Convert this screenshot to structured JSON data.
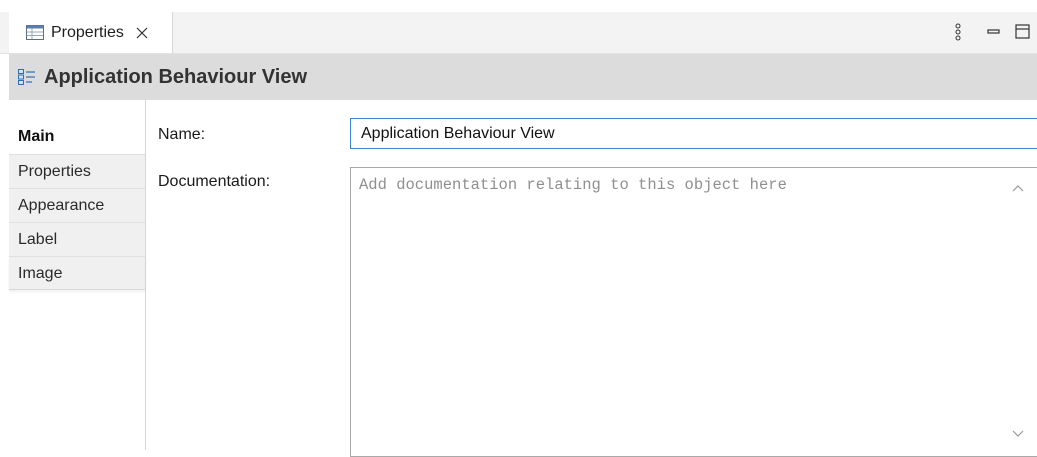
{
  "tab": {
    "label": "Properties",
    "icon": "properties-table-icon"
  },
  "toolbar": {
    "menu_icon": "view-menu-icon",
    "minimize_icon": "minimize-icon",
    "maximize_icon": "maximize-icon"
  },
  "header": {
    "title": "Application Behaviour View",
    "icon": "view-diagram-icon"
  },
  "sidebar": {
    "items": [
      {
        "label": "Main",
        "active": true
      },
      {
        "label": "Properties",
        "active": false
      },
      {
        "label": "Appearance",
        "active": false
      },
      {
        "label": "Label",
        "active": false
      },
      {
        "label": "Image",
        "active": false
      }
    ]
  },
  "form": {
    "name_label": "Name:",
    "name_value": "Application Behaviour View",
    "documentation_label": "Documentation:",
    "documentation_placeholder": "Add documentation relating to this object here"
  },
  "colors": {
    "focus_border": "#3d86d9",
    "header_bg": "#dcdcdc",
    "tabbar_bg": "#f3f3f3"
  }
}
